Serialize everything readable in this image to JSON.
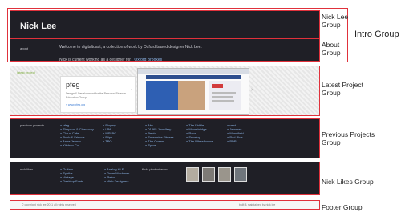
{
  "nick_lee_header": {
    "title": "Nick Lee"
  },
  "about": {
    "label": "about",
    "text": "Welcome to digitaltoast, a collection of work by Oxford based designer Nick Lee.",
    "text2": "Nick is current working as a designer for",
    "link": "Oxford Brookes"
  },
  "latest_project": {
    "tag": "latest project",
    "card_title": "pfeg",
    "card_desc": "Design & Development for the Personal Finance Education Group.",
    "card_link": "» www.pfeg.org"
  },
  "previous_projects": {
    "heading": "previous projects",
    "columns": [
      [
        "» pfeg",
        "» Simpson & Chauncey",
        "» Cloud Cafe",
        "» Bush & Friends",
        "» Anne Jenner",
        "» Kitchen-Co"
      ],
      [
        "» Ploymy",
        "» LPA",
        "» MSLBC",
        "» Blipp",
        "» TPO"
      ],
      [
        "» Abc",
        "» 01865 Jewellery",
        "» Bento",
        "» Enterprise Fitness",
        "» The Ocean",
        "» Spice"
      ],
      [
        "» The Fiddle",
        "» Moorsbridge",
        "» Rona",
        "» Sensing",
        "» The Wheelhouse"
      ],
      [
        "» next",
        "» Jemmes",
        "» Mannfield",
        "» Pod Blue",
        "» PDP"
      ]
    ]
  },
  "nick_likes": {
    "heading": "nick likes",
    "columns": [
      [
        "» Guitars",
        "» Synths",
        "» Vintage",
        "» Desktop Fonts"
      ],
      [
        "» Analog Hi-Fi",
        "» Drum Machines",
        "» Retro",
        "» Web Designers"
      ]
    ],
    "flickr_heading": "flickr photostream"
  },
  "footer": {
    "left": "© copyright nick lee 2011 all rights reserved",
    "right": "built & maintained by nick lee"
  },
  "annotations": {
    "nick_lee_group": "Nick Lee Group",
    "about_group": "About Group",
    "intro_group": "Intro Group",
    "latest_project_group": "Latest Project Group",
    "previous_projects_group": "Previous Projects Group",
    "nick_likes_group": "Nick Likes Group",
    "footer_group": "Footer Group"
  },
  "colors": {
    "highlight": "#e0313b",
    "panel": "#1f1f26",
    "link": "#8fb8ea"
  }
}
